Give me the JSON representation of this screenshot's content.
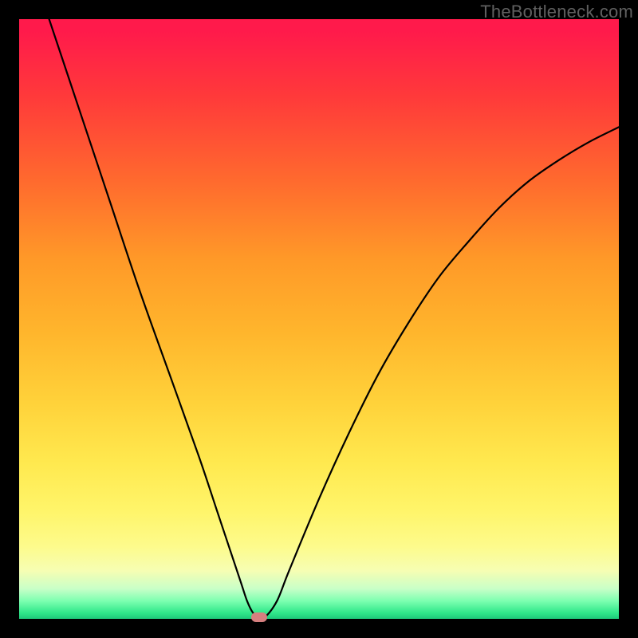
{
  "watermark": "TheBottleneck.com",
  "chart_data": {
    "type": "line",
    "title": "",
    "xlabel": "",
    "ylabel": "",
    "xlim": [
      0,
      100
    ],
    "ylim": [
      0,
      100
    ],
    "grid": false,
    "series": [
      {
        "name": "curve",
        "x": [
          5,
          10,
          15,
          20,
          25,
          30,
          33,
          35,
          37,
          38,
          39,
          40,
          41,
          43,
          45,
          50,
          55,
          60,
          65,
          70,
          75,
          80,
          85,
          90,
          95,
          100
        ],
        "values": [
          100,
          85,
          70,
          55,
          41,
          27,
          18,
          12,
          6,
          3,
          1,
          0.3,
          0.3,
          3,
          8,
          20,
          31,
          41,
          49.5,
          57,
          63,
          68.5,
          73,
          76.5,
          79.5,
          82
        ]
      }
    ],
    "marker": {
      "x": 40,
      "y": 0.3,
      "color": "#d67f7f"
    },
    "gradient_stops": [
      {
        "offset": 0,
        "color": "#ff1a4b"
      },
      {
        "offset": 50,
        "color": "#ffc533"
      },
      {
        "offset": 90,
        "color": "#fff98a"
      },
      {
        "offset": 100,
        "color": "#1ec97a"
      }
    ]
  }
}
